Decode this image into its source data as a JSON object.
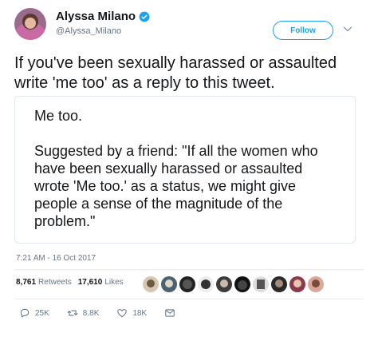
{
  "author": {
    "name": "Alyssa Milano",
    "handle": "@Alyssa_Milano",
    "verified": true
  },
  "follow_label": "Follow",
  "tweet_text": "If you've been sexually harassed or assaulted\nwrite 'me too' as a reply to this tweet.",
  "card_text": "Me too.\n\nSuggested by a friend: \"If all the women who\nhave been sexually harassed or assaulted\nwrote 'Me too.' as a status, we might give\npeople a sense of the magnitude of the\nproblem.\"",
  "timestamp": "7:21 AM - 16 Oct 2017",
  "stats": {
    "retweets_count": "8,761",
    "retweets_label": "Retweets",
    "likes_count": "17,610",
    "likes_label": "Likes"
  },
  "actions": {
    "reply": "25K",
    "retweet": "8.8K",
    "like": "18K"
  },
  "colors": {
    "accent": "#1da1f2",
    "muted": "#657786",
    "text": "#14171a"
  },
  "icons": [
    "verified-badge-icon",
    "chevron-down-icon",
    "reply-icon",
    "retweet-icon",
    "heart-icon",
    "message-icon"
  ]
}
